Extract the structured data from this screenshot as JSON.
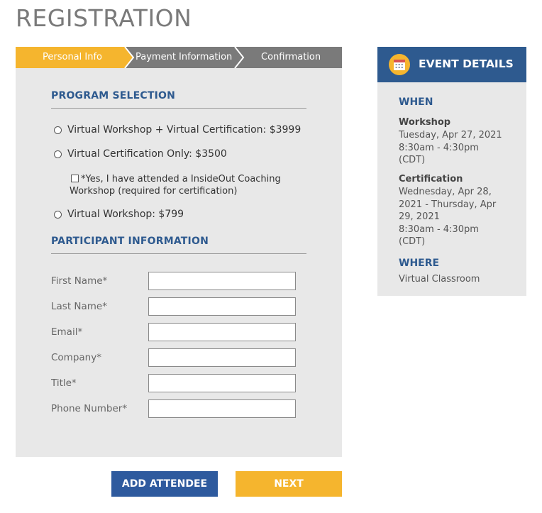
{
  "page": {
    "title": "REGISTRATION"
  },
  "steps": [
    {
      "label": "Personal Info",
      "active": true
    },
    {
      "label": "Payment Information",
      "active": false
    },
    {
      "label": "Confirmation",
      "active": false
    }
  ],
  "colors": {
    "step_active": "#f5b52e",
    "step_inactive": "#7a7a7a",
    "heading_blue": "#2e5a8f",
    "panel_bg": "#e8e8e8",
    "button_add": "#2e5a9e",
    "button_next": "#f5b52e"
  },
  "program": {
    "heading": "PROGRAM SELECTION",
    "options": [
      {
        "label": "Virtual Workshop + Virtual Certification: $3999",
        "selected": false
      },
      {
        "label": "Virtual Certification Only: $3500",
        "selected": false
      },
      {
        "label": "Virtual Workshop: $799",
        "selected": false
      }
    ],
    "attended_checkbox": {
      "label": "*Yes, I have attended a InsideOut Coaching Workshop (required for certification)",
      "checked": false
    }
  },
  "participant": {
    "heading": "PARTICIPANT INFORMATION",
    "fields": [
      {
        "label": "First Name*",
        "value": ""
      },
      {
        "label": "Last Name*",
        "value": ""
      },
      {
        "label": "Email*",
        "value": ""
      },
      {
        "label": "Company*",
        "value": ""
      },
      {
        "label": "Title*",
        "value": ""
      },
      {
        "label": "Phone Number*",
        "value": ""
      }
    ]
  },
  "buttons": {
    "add_attendee": "ADD ATTENDEE",
    "next": "NEXT"
  },
  "event": {
    "header": "EVENT DETAILS",
    "icon": "calendar-icon",
    "when_heading": "WHEN",
    "workshop_title": "Workshop",
    "workshop_lines": [
      "Tuesday, Apr 27, 2021",
      "8:30am - 4:30pm",
      "(CDT)"
    ],
    "certification_title": "Certification",
    "certification_lines": [
      "Wednesday, Apr 28,",
      "2021 - Thursday, Apr",
      "29, 2021",
      "8:30am - 4:30pm",
      "(CDT)"
    ],
    "where_heading": "WHERE",
    "where_value": "Virtual Classroom"
  }
}
